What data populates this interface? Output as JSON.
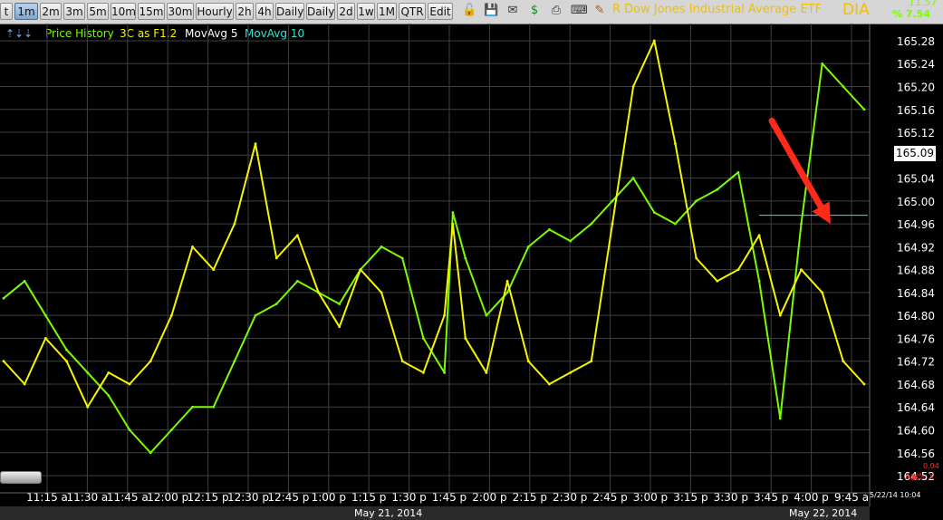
{
  "toolbar": {
    "timeframes": [
      "t",
      "1m",
      "2m",
      "3m",
      "5m",
      "10m",
      "15m",
      "30m",
      "Hourly",
      "2h",
      "4h",
      "Daily",
      "Daily",
      "2d",
      "1w",
      "1M",
      "QTR",
      "Edit"
    ],
    "selected": "1m",
    "symbol_name": "R Dow Jones Industrial Average ETF",
    "ticker": "DIA",
    "last_change": "11.57",
    "pct_change": "% 7.54",
    "icons": [
      "lock-icon",
      "save-icon",
      "email-icon",
      "dollar-icon",
      "print-icon",
      "keyboard-icon",
      "pencil-icon"
    ]
  },
  "legend": {
    "arrows": "⇡⇣⇣",
    "items": [
      {
        "label": "Price History",
        "color": "#7cfc00"
      },
      {
        "label": "3C as F1.2",
        "color": "#f5f500"
      },
      {
        "label": "MovAvg 5",
        "color": "#ffffff"
      },
      {
        "label": "MovAvg 10",
        "color": "#40e0d0"
      }
    ]
  },
  "current_price": "165.09",
  "small_labels": {
    "top": "0.04",
    "bottom": "A▣% X"
  },
  "timestamp": "5/22/14 10:04",
  "dates": {
    "day1": "May 21, 2014",
    "day2": "May 22, 2014"
  },
  "colors": {
    "price": "#7cfc00",
    "indicator": "#f5f500",
    "grid": "#404040",
    "arrow": "#ff2a1a",
    "ma10": "#40e0d0"
  },
  "chart_data": {
    "type": "line",
    "x_ticks": [
      "11:15 a",
      "11:30 a",
      "11:45 a",
      "12:00 p",
      "12:15 p",
      "12:30 p",
      "12:45 p",
      "1:00 p",
      "1:15 p",
      "1:30 p",
      "1:45 p",
      "2:00 p",
      "2:15 p",
      "2:30 p",
      "2:45 p",
      "3:00 p",
      "3:15 p",
      "3:30 p",
      "3:45 p",
      "4:00 p",
      "9:45 a"
    ],
    "y_ticks": [
      164.52,
      164.56,
      164.6,
      164.64,
      164.68,
      164.72,
      164.76,
      164.8,
      164.84,
      164.88,
      164.92,
      164.96,
      165.0,
      165.04,
      165.08,
      165.12,
      165.16,
      165.2,
      165.24,
      165.28
    ],
    "ylim": [
      164.49,
      165.31
    ],
    "x": [
      0,
      5,
      10,
      15,
      20,
      25,
      30,
      35,
      40,
      45,
      50,
      55,
      60,
      65,
      70,
      75,
      80,
      85,
      90,
      95,
      100,
      105,
      107,
      110,
      115,
      120,
      125,
      130,
      135,
      140,
      145,
      150,
      155,
      160,
      165,
      170,
      175,
      180,
      185,
      190,
      195,
      200,
      205
    ],
    "series": [
      {
        "name": "Price History",
        "color": "#7cfc00",
        "values": [
          164.83,
          164.86,
          164.8,
          164.74,
          164.7,
          164.66,
          164.6,
          164.56,
          164.6,
          164.64,
          164.64,
          164.72,
          164.8,
          164.82,
          164.86,
          164.84,
          164.82,
          164.88,
          164.92,
          164.9,
          164.76,
          164.7,
          164.98,
          164.9,
          164.8,
          164.84,
          164.92,
          164.95,
          164.93,
          164.96,
          165.0,
          165.04,
          164.98,
          164.96,
          165.0,
          165.02,
          165.05,
          164.86,
          164.62,
          164.96,
          165.24,
          165.2,
          165.16
        ]
      },
      {
        "name": "3C as F1.2",
        "color": "#f5f500",
        "values": [
          164.72,
          164.68,
          164.76,
          164.72,
          164.64,
          164.7,
          164.68,
          164.72,
          164.8,
          164.92,
          164.88,
          164.96,
          165.1,
          164.9,
          164.94,
          164.84,
          164.78,
          164.88,
          164.84,
          164.72,
          164.7,
          164.8,
          164.96,
          164.76,
          164.7,
          164.86,
          164.72,
          164.68,
          164.7,
          164.72,
          164.96,
          165.2,
          165.28,
          165.1,
          164.9,
          164.86,
          164.88,
          164.94,
          164.8,
          164.88,
          164.84,
          164.72,
          164.68
        ]
      }
    ],
    "annotation": {
      "type": "arrow",
      "from": [
        165.14,
        183
      ],
      "to": [
        164.96,
        197
      ]
    }
  }
}
